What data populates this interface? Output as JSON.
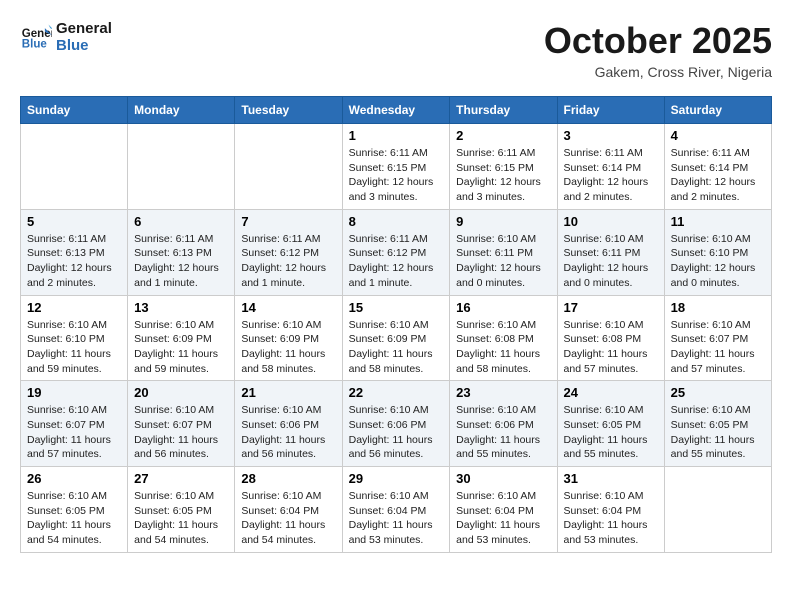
{
  "header": {
    "logo_line1": "General",
    "logo_line2": "Blue",
    "month_title": "October 2025",
    "subtitle": "Gakem, Cross River, Nigeria"
  },
  "weekdays": [
    "Sunday",
    "Monday",
    "Tuesday",
    "Wednesday",
    "Thursday",
    "Friday",
    "Saturday"
  ],
  "weeks": [
    [
      {
        "num": "",
        "info": ""
      },
      {
        "num": "",
        "info": ""
      },
      {
        "num": "",
        "info": ""
      },
      {
        "num": "1",
        "info": "Sunrise: 6:11 AM\nSunset: 6:15 PM\nDaylight: 12 hours and 3 minutes."
      },
      {
        "num": "2",
        "info": "Sunrise: 6:11 AM\nSunset: 6:15 PM\nDaylight: 12 hours and 3 minutes."
      },
      {
        "num": "3",
        "info": "Sunrise: 6:11 AM\nSunset: 6:14 PM\nDaylight: 12 hours and 2 minutes."
      },
      {
        "num": "4",
        "info": "Sunrise: 6:11 AM\nSunset: 6:14 PM\nDaylight: 12 hours and 2 minutes."
      }
    ],
    [
      {
        "num": "5",
        "info": "Sunrise: 6:11 AM\nSunset: 6:13 PM\nDaylight: 12 hours and 2 minutes."
      },
      {
        "num": "6",
        "info": "Sunrise: 6:11 AM\nSunset: 6:13 PM\nDaylight: 12 hours and 1 minute."
      },
      {
        "num": "7",
        "info": "Sunrise: 6:11 AM\nSunset: 6:12 PM\nDaylight: 12 hours and 1 minute."
      },
      {
        "num": "8",
        "info": "Sunrise: 6:11 AM\nSunset: 6:12 PM\nDaylight: 12 hours and 1 minute."
      },
      {
        "num": "9",
        "info": "Sunrise: 6:10 AM\nSunset: 6:11 PM\nDaylight: 12 hours and 0 minutes."
      },
      {
        "num": "10",
        "info": "Sunrise: 6:10 AM\nSunset: 6:11 PM\nDaylight: 12 hours and 0 minutes."
      },
      {
        "num": "11",
        "info": "Sunrise: 6:10 AM\nSunset: 6:10 PM\nDaylight: 12 hours and 0 minutes."
      }
    ],
    [
      {
        "num": "12",
        "info": "Sunrise: 6:10 AM\nSunset: 6:10 PM\nDaylight: 11 hours and 59 minutes."
      },
      {
        "num": "13",
        "info": "Sunrise: 6:10 AM\nSunset: 6:09 PM\nDaylight: 11 hours and 59 minutes."
      },
      {
        "num": "14",
        "info": "Sunrise: 6:10 AM\nSunset: 6:09 PM\nDaylight: 11 hours and 58 minutes."
      },
      {
        "num": "15",
        "info": "Sunrise: 6:10 AM\nSunset: 6:09 PM\nDaylight: 11 hours and 58 minutes."
      },
      {
        "num": "16",
        "info": "Sunrise: 6:10 AM\nSunset: 6:08 PM\nDaylight: 11 hours and 58 minutes."
      },
      {
        "num": "17",
        "info": "Sunrise: 6:10 AM\nSunset: 6:08 PM\nDaylight: 11 hours and 57 minutes."
      },
      {
        "num": "18",
        "info": "Sunrise: 6:10 AM\nSunset: 6:07 PM\nDaylight: 11 hours and 57 minutes."
      }
    ],
    [
      {
        "num": "19",
        "info": "Sunrise: 6:10 AM\nSunset: 6:07 PM\nDaylight: 11 hours and 57 minutes."
      },
      {
        "num": "20",
        "info": "Sunrise: 6:10 AM\nSunset: 6:07 PM\nDaylight: 11 hours and 56 minutes."
      },
      {
        "num": "21",
        "info": "Sunrise: 6:10 AM\nSunset: 6:06 PM\nDaylight: 11 hours and 56 minutes."
      },
      {
        "num": "22",
        "info": "Sunrise: 6:10 AM\nSunset: 6:06 PM\nDaylight: 11 hours and 56 minutes."
      },
      {
        "num": "23",
        "info": "Sunrise: 6:10 AM\nSunset: 6:06 PM\nDaylight: 11 hours and 55 minutes."
      },
      {
        "num": "24",
        "info": "Sunrise: 6:10 AM\nSunset: 6:05 PM\nDaylight: 11 hours and 55 minutes."
      },
      {
        "num": "25",
        "info": "Sunrise: 6:10 AM\nSunset: 6:05 PM\nDaylight: 11 hours and 55 minutes."
      }
    ],
    [
      {
        "num": "26",
        "info": "Sunrise: 6:10 AM\nSunset: 6:05 PM\nDaylight: 11 hours and 54 minutes."
      },
      {
        "num": "27",
        "info": "Sunrise: 6:10 AM\nSunset: 6:05 PM\nDaylight: 11 hours and 54 minutes."
      },
      {
        "num": "28",
        "info": "Sunrise: 6:10 AM\nSunset: 6:04 PM\nDaylight: 11 hours and 54 minutes."
      },
      {
        "num": "29",
        "info": "Sunrise: 6:10 AM\nSunset: 6:04 PM\nDaylight: 11 hours and 53 minutes."
      },
      {
        "num": "30",
        "info": "Sunrise: 6:10 AM\nSunset: 6:04 PM\nDaylight: 11 hours and 53 minutes."
      },
      {
        "num": "31",
        "info": "Sunrise: 6:10 AM\nSunset: 6:04 PM\nDaylight: 11 hours and 53 minutes."
      },
      {
        "num": "",
        "info": ""
      }
    ]
  ]
}
